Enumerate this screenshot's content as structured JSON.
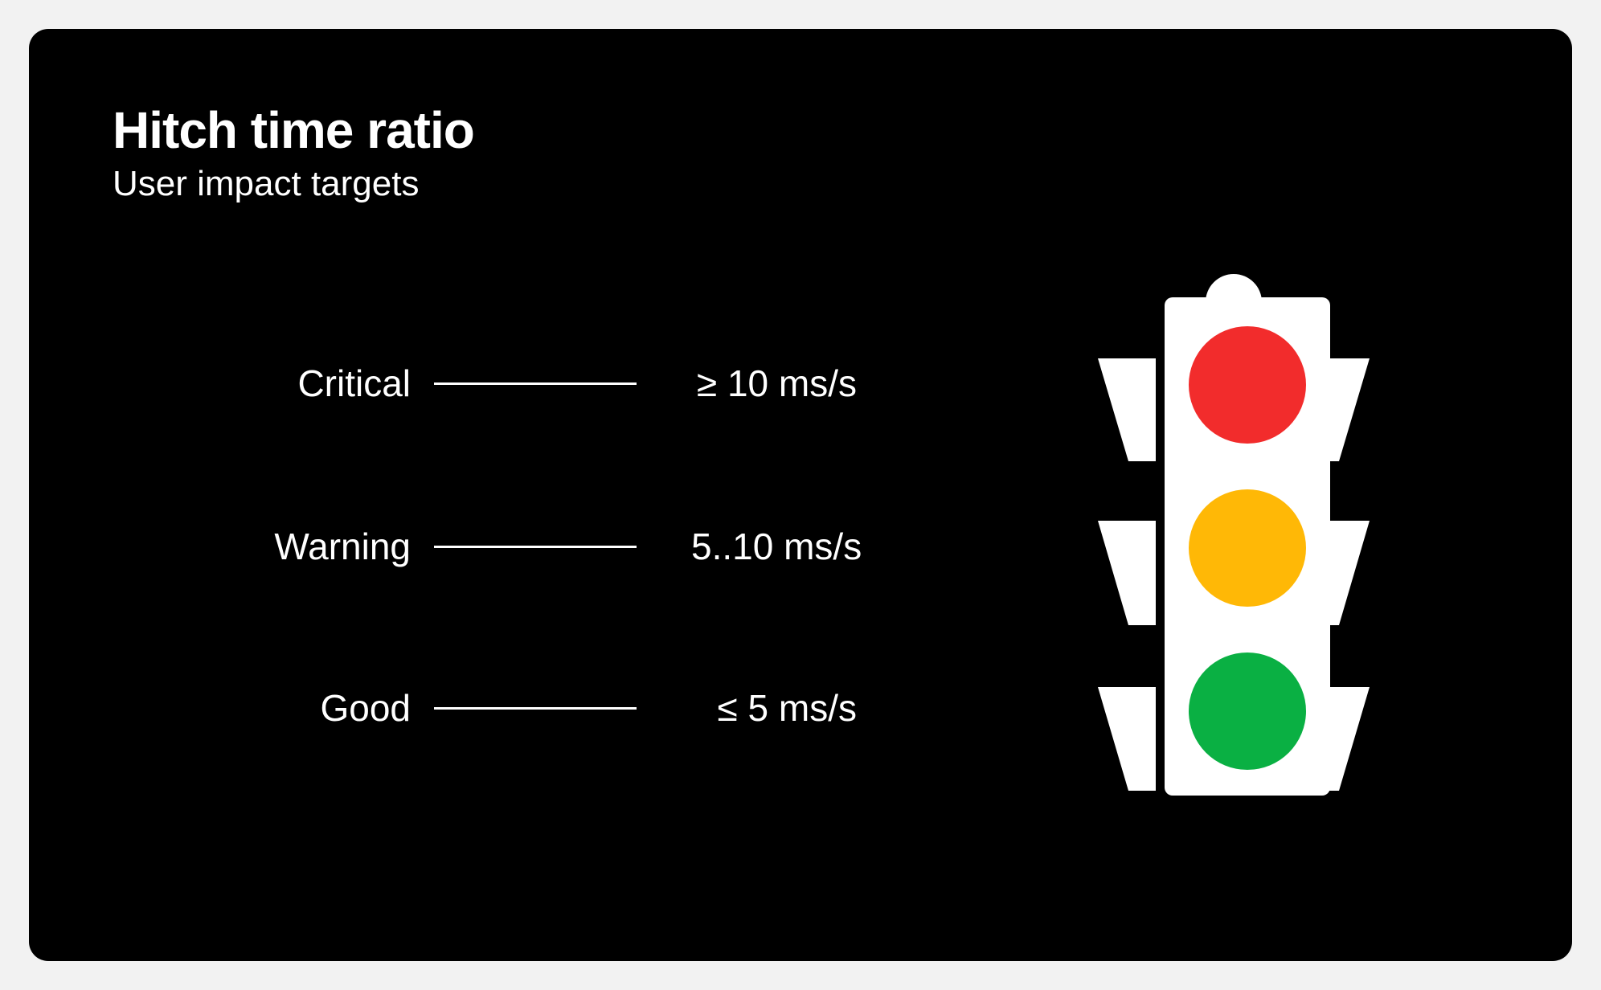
{
  "slide": {
    "title": "Hitch time ratio",
    "subtitle": "User impact targets"
  },
  "thresholds": [
    {
      "label": "Critical",
      "value": "≥ 10 ms/s",
      "light_color": "#f22c2c"
    },
    {
      "label": "Warning",
      "value": "5..10 ms/s",
      "light_color": "#ffb806"
    },
    {
      "label": "Good",
      "value": "≤ 5 ms/s",
      "light_color": "#0ab043"
    }
  ],
  "colors": {
    "background": "#000000",
    "text": "#ffffff",
    "traffic_light_body": "#ffffff"
  },
  "icons": {
    "traffic_light": "traffic-light-icon"
  }
}
